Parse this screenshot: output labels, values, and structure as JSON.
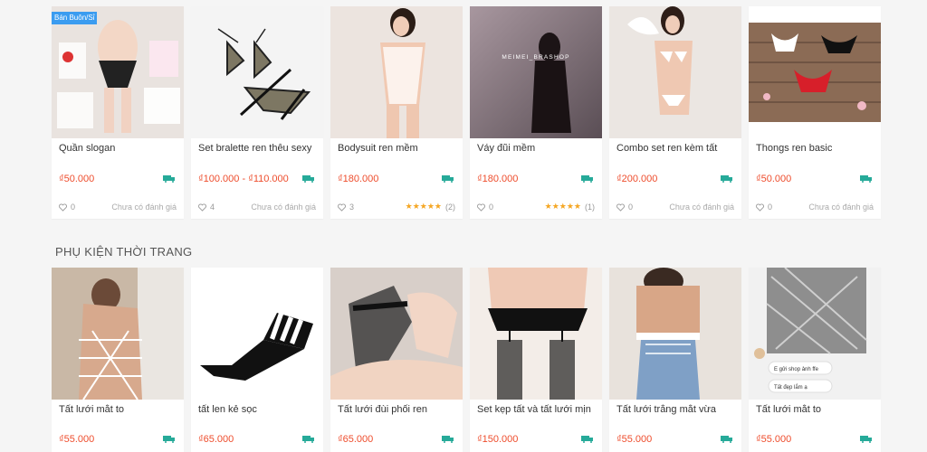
{
  "section_title": "PHỤ KIỆN THỜI TRANG",
  "row1": [
    {
      "badge": "Bán Buôn/Sỉ",
      "name": "Quần slogan",
      "price": "₫50.000",
      "likes": "0",
      "rating_text": "Chưa có đánh giá",
      "thumb_bg": "#e9e3df"
    },
    {
      "name": "Set bralette ren thêu sexy",
      "price": "₫100.000 - ₫110.000",
      "likes": "4",
      "rating_text": "Chưa có đánh giá",
      "thumb_bg": "#f4f4f4"
    },
    {
      "name": "Bodysuit ren mềm",
      "price": "₫180.000",
      "likes": "3",
      "stars": "★★★★★",
      "rating_count": "(2)",
      "thumb_bg": "#ece4df"
    },
    {
      "name": "Váy đũi mềm",
      "price": "₫180.000",
      "likes": "0",
      "stars": "★★★★★",
      "rating_count": "(1)",
      "watermark": "MEIMEI_BRASHOP",
      "thumb_bg": "#8c7f86"
    },
    {
      "name": "Combo set ren kèm tất",
      "price": "₫200.000",
      "likes": "0",
      "rating_text": "Chưa có đánh giá",
      "thumb_bg": "#ebe6e2"
    },
    {
      "name": "Thongs ren basic",
      "price": "₫50.000",
      "likes": "0",
      "rating_text": "Chưa có đánh giá",
      "thumb_bg": "#8b6b55"
    }
  ],
  "row2": [
    {
      "name": "Tất lưới mắt to",
      "price": "₫55.000",
      "thumb_bg": "#c9b8a6"
    },
    {
      "name": "tất len kẻ sọc",
      "price": "₫65.000",
      "thumb_bg": "#ffffff"
    },
    {
      "name": "Tất lưới đùi phối ren",
      "price": "₫65.000",
      "thumb_bg": "#d8cfc9"
    },
    {
      "name": "Set kẹp tất và tất lưới mịn",
      "price": "₫150.000",
      "thumb_bg": "#f3ede8"
    },
    {
      "name": "Tất lưới trắng mắt vừa",
      "price": "₫55.000",
      "thumb_bg": "#e8e2dc"
    },
    {
      "name": "Tất lưới mắt to",
      "price": "₫55.000",
      "thumb_bg": "#f1f1f1",
      "chat1": "E gửi shop ảnh ffe",
      "chat2": "Tất đẹp lắm ạ"
    }
  ],
  "colors": {
    "price": "#ee4d2d",
    "badge": "#3b9cf0",
    "freeship": "#26aa99",
    "stars": "#f5a623"
  },
  "icons": {
    "freeship": "freeship-truck-icon",
    "heart": "heart-outline-icon"
  }
}
